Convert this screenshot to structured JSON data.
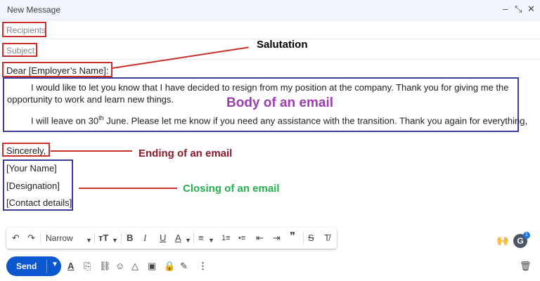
{
  "window": {
    "title": "New Message",
    "minimize_icon": "minimize-icon",
    "expand_icon": "expand-icon",
    "close_icon": "close-icon"
  },
  "fields": {
    "recipients_placeholder": "Recipients",
    "subject_placeholder": "Subject"
  },
  "email": {
    "salutation": "Dear [Employer’s Name]:",
    "body_para1": "I would like to let you know that I have decided to resign from my position at the company. Thank you for giving me the opportunity to work and learn new things.",
    "body_para2_before": "I will leave on 30",
    "body_para2_sup": "th",
    "body_para2_after": " June. Please let me know if you need any assistance with the transition. Thank you again for everything,",
    "ending": "Sincerely,",
    "closing": [
      "[Your Name]",
      "[Designation]",
      "[Contact details]"
    ]
  },
  "annotations": {
    "salutation": "Salutation",
    "body": "Body of an email",
    "ending": "Ending of an email",
    "closing": "Closing of an email",
    "colors": {
      "salutation": "#000000",
      "body": "#9b3fb0",
      "ending": "#8b1a2b",
      "closing": "#22b14c",
      "redbox": "#c9302c",
      "bluebox": "#3c3c9c"
    }
  },
  "toolbar": {
    "undo": "↶",
    "redo": "↷",
    "font": "Narrow",
    "size": "тT",
    "bold": "B",
    "italic": "I",
    "underline": "U",
    "text_color": "A",
    "align": "≡",
    "numbered": "1≡",
    "bulleted": "•≡",
    "outdent": "⇤",
    "indent": "⇥",
    "quote": "❞",
    "strike": "S",
    "clear": "T̸"
  },
  "bottom": {
    "send_label": "Send",
    "avatar_letter": "G",
    "avatar_badge": "1",
    "accent": "#0b57d0"
  }
}
